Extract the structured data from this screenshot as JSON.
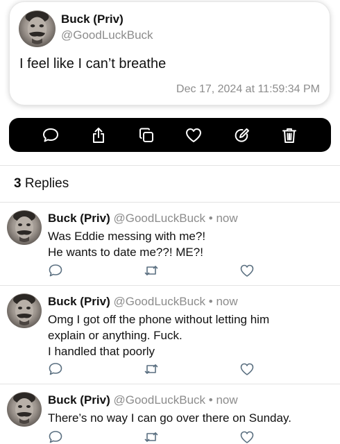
{
  "post": {
    "name": "Buck (Priv)",
    "handle": "@GoodLuckBuck",
    "text": "I feel like I can’t breathe",
    "timestamp": "Dec 17, 2024 at 11:59:34 PM"
  },
  "actions": [
    "comment-icon",
    "share-icon",
    "copy-icon",
    "heart-icon",
    "edit-icon",
    "trash-icon"
  ],
  "replies_header": {
    "count": "3",
    "label": "Replies"
  },
  "replies": [
    {
      "name": "Buck (Priv)",
      "handle": "@GoodLuckBuck",
      "separator": "•",
      "time": "now",
      "lines": [
        "Was Eddie messing with me?!",
        "He wants to date me??! ME?!"
      ]
    },
    {
      "name": "Buck (Priv)",
      "handle": "@GoodLuckBuck",
      "separator": "•",
      "time": "now",
      "lines": [
        "Omg I got off the phone without letting him",
        "explain or anything. Fuck.",
        "I handled that poorly"
      ]
    },
    {
      "name": "Buck (Priv)",
      "handle": "@GoodLuckBuck",
      "separator": "•",
      "time": "now",
      "lines": [
        "There’s no way I can go over there on Sunday."
      ]
    }
  ],
  "colors": {
    "action_bar": "#000000",
    "secondary_text": "#8c8c8c",
    "reply_icon": "#5a6f80"
  }
}
